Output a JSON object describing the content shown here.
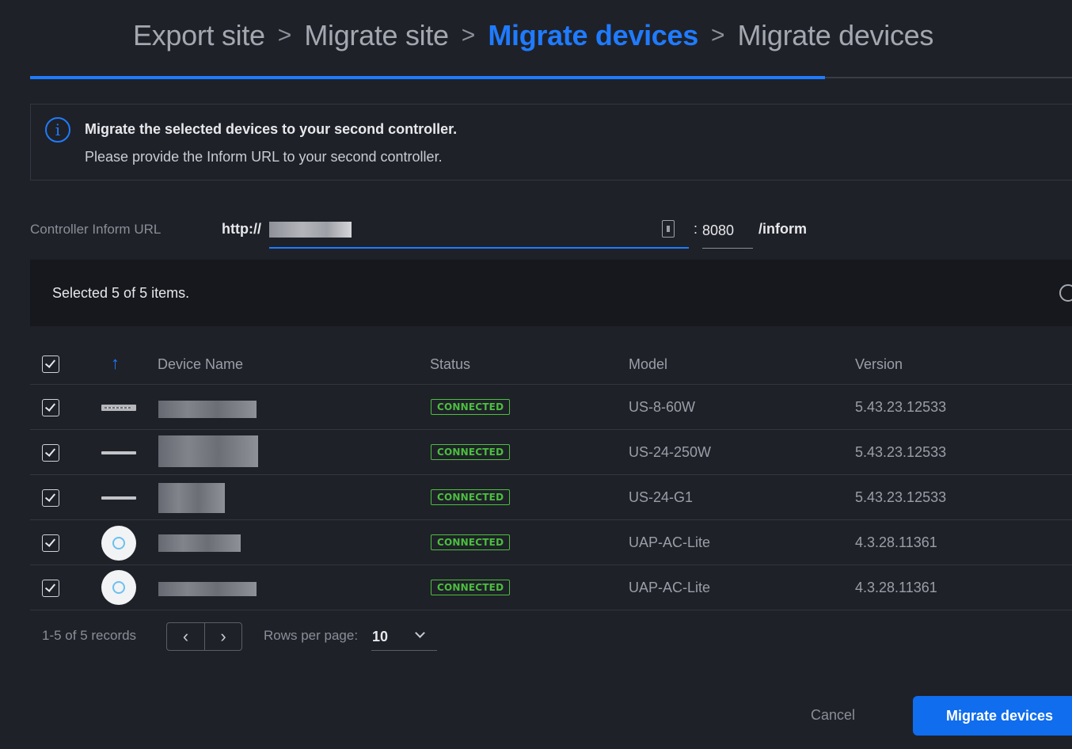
{
  "stepper": {
    "steps": [
      {
        "label": "Export site",
        "active": false
      },
      {
        "label": "Migrate site",
        "active": false
      },
      {
        "label": "Migrate devices",
        "active": true
      },
      {
        "label": "Migrate devices",
        "active": false
      }
    ],
    "separator": ">",
    "progress_percent": 76
  },
  "info": {
    "icon": "info-icon",
    "title": "Migrate the selected devices to your second controller.",
    "subtitle": "Please provide the Inform URL to your second controller."
  },
  "inform_url": {
    "label": "Controller Inform URL",
    "prefix": "http://",
    "host_value": "",
    "port_separator": ":",
    "port_value": "8080",
    "suffix": "/inform"
  },
  "table": {
    "selected_text": "Selected 5 of 5 items.",
    "columns": [
      "Device Name",
      "Status",
      "Model",
      "Version"
    ],
    "rows": [
      {
        "checked": true,
        "device_icon": "switch-icon",
        "status": "CONNECTED",
        "model": "US-8-60W",
        "version": "5.43.23.12533"
      },
      {
        "checked": true,
        "device_icon": "switch-icon",
        "status": "CONNECTED",
        "model": "US-24-250W",
        "version": "5.43.23.12533"
      },
      {
        "checked": true,
        "device_icon": "switch-icon",
        "status": "CONNECTED",
        "model": "US-24-G1",
        "version": "5.43.23.12533"
      },
      {
        "checked": true,
        "device_icon": "access-point-icon",
        "status": "CONNECTED",
        "model": "UAP-AC-Lite",
        "version": "4.3.28.11361"
      },
      {
        "checked": true,
        "device_icon": "access-point-icon",
        "status": "CONNECTED",
        "model": "UAP-AC-Lite",
        "version": "4.3.28.11361"
      }
    ]
  },
  "footer": {
    "records": "1-5 of 5 records",
    "rows_per_page_label": "Rows per page:",
    "rows_per_page_value": "10",
    "cancel_label": "Cancel",
    "primary_label": "Migrate devices"
  },
  "colors": {
    "accent": "#1f7bff",
    "background": "#1f2128",
    "status_connected": "#4bbf3f"
  }
}
